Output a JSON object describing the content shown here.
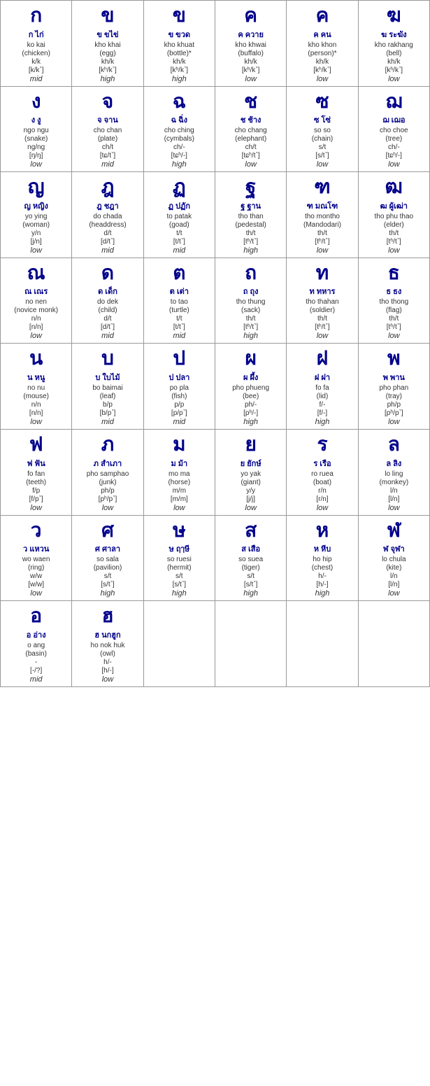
{
  "rows": [
    [
      {
        "thai": "ก",
        "name": "ก ไก่",
        "roman": "ko kai",
        "paren": "(chicken)",
        "phoneme": "k/k",
        "ipa": "[k/k˺]",
        "tone": "mid"
      },
      {
        "thai": "ข",
        "name": "ข ขไข่",
        "roman": "kho khai",
        "paren": "(egg)",
        "phoneme": "kh/k",
        "ipa": "[kʰ/k˺]",
        "tone": "high"
      },
      {
        "thai": "ข",
        "name": "ข ขวด",
        "roman": "kho khuat",
        "paren": "(bottle)*",
        "phoneme": "kh/k",
        "ipa": "[kʰ/k˺]",
        "tone": "high"
      },
      {
        "thai": "ค",
        "name": "ค ควาย",
        "roman": "kho khwai",
        "paren": "(buffalo)",
        "phoneme": "kh/k",
        "ipa": "[kʰ/k˺]",
        "tone": "low"
      },
      {
        "thai": "ค",
        "name": "ค คน",
        "roman": "kho khon",
        "paren": "(person)*",
        "phoneme": "kh/k",
        "ipa": "[kʰ/k˺]",
        "tone": "low"
      },
      {
        "thai": "ฆ",
        "name": "ฆ ระฆัง",
        "roman": "kho rakhang",
        "paren": "(bell)",
        "phoneme": "kh/k",
        "ipa": "[kʰ/k˺]",
        "tone": "low"
      }
    ],
    [
      {
        "thai": "ง",
        "name": "ง งู",
        "roman": "ngo ngu",
        "paren": "(snake)",
        "phoneme": "ng/ng",
        "ipa": "[ŋ/ŋ]",
        "tone": "low"
      },
      {
        "thai": "จ",
        "name": "จ จาน",
        "roman": "cho chan",
        "paren": "(plate)",
        "phoneme": "ch/t",
        "ipa": "[tɕ/t˺]",
        "tone": "mid"
      },
      {
        "thai": "ฉ",
        "name": "ฉ ฉิ่ง",
        "roman": "cho ching",
        "paren": "(cymbals)",
        "phoneme": "ch/-",
        "ipa": "[tɕʰ/-]",
        "tone": "high"
      },
      {
        "thai": "ช",
        "name": "ช ช้าง",
        "roman": "cho chang",
        "paren": "(elephant)",
        "phoneme": "ch/t",
        "ipa": "[tɕʰ/t˺]",
        "tone": "low"
      },
      {
        "thai": "ซ",
        "name": "ซ โซ่",
        "roman": "so so",
        "paren": "(chain)",
        "phoneme": "s/t",
        "ipa": "[s/t˺]",
        "tone": "low"
      },
      {
        "thai": "ฌ",
        "name": "ฌ เฌอ",
        "roman": "cho choe",
        "paren": "(tree)",
        "phoneme": "ch/-",
        "ipa": "[tɕʰ/-]",
        "tone": "low"
      }
    ],
    [
      {
        "thai": "ญ",
        "name": "ญ หญิง",
        "roman": "yo ying",
        "paren": "(woman)",
        "phoneme": "y/n",
        "ipa": "[j/n]",
        "tone": "low"
      },
      {
        "thai": "ฎ",
        "name": "ฎ ชฎา",
        "roman": "do chada",
        "paren": "(headdress)",
        "phoneme": "d/t",
        "ipa": "[d/t˺]",
        "tone": "mid"
      },
      {
        "thai": "ฏ",
        "name": "ฏ ปฏัก",
        "roman": "to patak",
        "paren": "(goad)",
        "phoneme": "t/t",
        "ipa": "[t/t˺]",
        "tone": "mid"
      },
      {
        "thai": "ฐ",
        "name": "ฐ ฐาน",
        "roman": "tho than",
        "paren": "(pedestal)",
        "phoneme": "th/t",
        "ipa": "[tʰ/t˺]",
        "tone": "high"
      },
      {
        "thai": "ฑ",
        "name": "ฑ มณโฑ",
        "roman": "tho montho",
        "paren": "(Mandodari)",
        "phoneme": "th/t",
        "ipa": "[tʰ/t˺]",
        "tone": "low"
      },
      {
        "thai": "ฒ",
        "name": "ฒ ผู้เฒ่า",
        "roman": "tho phu thao",
        "paren": "(elder)",
        "phoneme": "th/t",
        "ipa": "[tʰ/t˺]",
        "tone": "low"
      }
    ],
    [
      {
        "thai": "ณ",
        "name": "ณ เณร",
        "roman": "no nen",
        "paren": "(novice monk)",
        "phoneme": "n/n",
        "ipa": "[n/n]",
        "tone": "low"
      },
      {
        "thai": "ด",
        "name": "ด เด็ก",
        "roman": "do dek",
        "paren": "(child)",
        "phoneme": "d/t",
        "ipa": "[d/t˺]",
        "tone": "mid"
      },
      {
        "thai": "ต",
        "name": "ต เต่า",
        "roman": "to tao",
        "paren": "(turtle)",
        "phoneme": "t/t",
        "ipa": "[t/t˺]",
        "tone": "mid"
      },
      {
        "thai": "ถ",
        "name": "ถ ถุง",
        "roman": "tho thung",
        "paren": "(sack)",
        "phoneme": "th/t",
        "ipa": "[tʰ/t˺]",
        "tone": "high"
      },
      {
        "thai": "ท",
        "name": "ท ทหาร",
        "roman": "tho thahan",
        "paren": "(soldier)",
        "phoneme": "th/t",
        "ipa": "[tʰ/t˺]",
        "tone": "low"
      },
      {
        "thai": "ธ",
        "name": "ธ ธง",
        "roman": "tho thong",
        "paren": "(flag)",
        "phoneme": "th/t",
        "ipa": "[tʰ/t˺]",
        "tone": "low"
      }
    ],
    [
      {
        "thai": "น",
        "name": "น หนู",
        "roman": "no nu",
        "paren": "(mouse)",
        "phoneme": "n/n",
        "ipa": "[n/n]",
        "tone": "low"
      },
      {
        "thai": "บ",
        "name": "บ ใบไม้",
        "roman": "bo baimai",
        "paren": "(leaf)",
        "phoneme": "b/p",
        "ipa": "[b/p˺]",
        "tone": "mid"
      },
      {
        "thai": "ป",
        "name": "ป ปลา",
        "roman": "po pla",
        "paren": "(fish)",
        "phoneme": "p/p",
        "ipa": "[p/p˺]",
        "tone": "mid"
      },
      {
        "thai": "ผ",
        "name": "ผ ผึ้ง",
        "roman": "pho phueng",
        "paren": "(bee)",
        "phoneme": "ph/-",
        "ipa": "[pʰ/-]",
        "tone": "high"
      },
      {
        "thai": "ฝ",
        "name": "ฝ ฝา",
        "roman": "fo fa",
        "paren": "(lid)",
        "phoneme": "f/-",
        "ipa": "[f/-]",
        "tone": "high"
      },
      {
        "thai": "พ",
        "name": "พ พาน",
        "roman": "pho phan",
        "paren": "(tray)",
        "phoneme": "ph/p",
        "ipa": "[pʰ/p˺]",
        "tone": "low"
      }
    ],
    [
      {
        "thai": "ฟ",
        "name": "ฟ ฟัน",
        "roman": "fo fan",
        "paren": "(teeth)",
        "phoneme": "f/p",
        "ipa": "[f/p˺]",
        "tone": "low"
      },
      {
        "thai": "ภ",
        "name": "ภ สำเภา",
        "roman": "pho samphao",
        "paren": "(junk)",
        "phoneme": "ph/p",
        "ipa": "[pʰ/p˺]",
        "tone": "low"
      },
      {
        "thai": "ม",
        "name": "ม ม้า",
        "roman": "mo ma",
        "paren": "(horse)",
        "phoneme": "m/m",
        "ipa": "[m/m]",
        "tone": "low"
      },
      {
        "thai": "ย",
        "name": "ย ยักษ์",
        "roman": "yo yak",
        "paren": "(giant)",
        "phoneme": "y/y",
        "ipa": "[j/j]",
        "tone": "low"
      },
      {
        "thai": "ร",
        "name": "ร เรือ",
        "roman": "ro ruea",
        "paren": "(boat)",
        "phoneme": "r/n",
        "ipa": "[r/n]",
        "tone": "low"
      },
      {
        "thai": "ล",
        "name": "ล ลิง",
        "roman": "lo ling",
        "paren": "(monkey)",
        "phoneme": "l/n",
        "ipa": "[l/n]",
        "tone": "low"
      }
    ],
    [
      {
        "thai": "ว",
        "name": "ว แหวน",
        "roman": "wo waen",
        "paren": "(ring)",
        "phoneme": "w/w",
        "ipa": "[w/w]",
        "tone": "low"
      },
      {
        "thai": "ศ",
        "name": "ศ ศาลา",
        "roman": "so sala",
        "paren": "(pavilion)",
        "phoneme": "s/t",
        "ipa": "[s/t˺]",
        "tone": "high"
      },
      {
        "thai": "ษ",
        "name": "ษ ฤๅษี",
        "roman": "so ruesi",
        "paren": "(hermit)",
        "phoneme": "s/t",
        "ipa": "[s/t˺]",
        "tone": "high"
      },
      {
        "thai": "ส",
        "name": "ส เสือ",
        "roman": "so suea",
        "paren": "(tiger)",
        "phoneme": "s/t",
        "ipa": "[s/t˺]",
        "tone": "high"
      },
      {
        "thai": "ห",
        "name": "ห หีบ",
        "roman": "ho hip",
        "paren": "(chest)",
        "phoneme": "h/-",
        "ipa": "[h/-]",
        "tone": "high"
      },
      {
        "thai": "ฬ",
        "name": "ฬ จุฬา",
        "roman": "lo chula",
        "paren": "(kite)",
        "phoneme": "l/n",
        "ipa": "[l/n]",
        "tone": "low"
      }
    ],
    [
      {
        "thai": "อ",
        "name": "อ อ่าง",
        "roman": "o ang",
        "paren": "(basin)",
        "phoneme": "-",
        "ipa": "[-/?]",
        "tone": "mid"
      },
      {
        "thai": "ฮ",
        "name": "ฮ นกฮูก",
        "roman": "ho nok huk",
        "paren": "(owl)",
        "phoneme": "h/-",
        "ipa": "[h/-]",
        "tone": "low"
      },
      null,
      null,
      null,
      null
    ]
  ]
}
